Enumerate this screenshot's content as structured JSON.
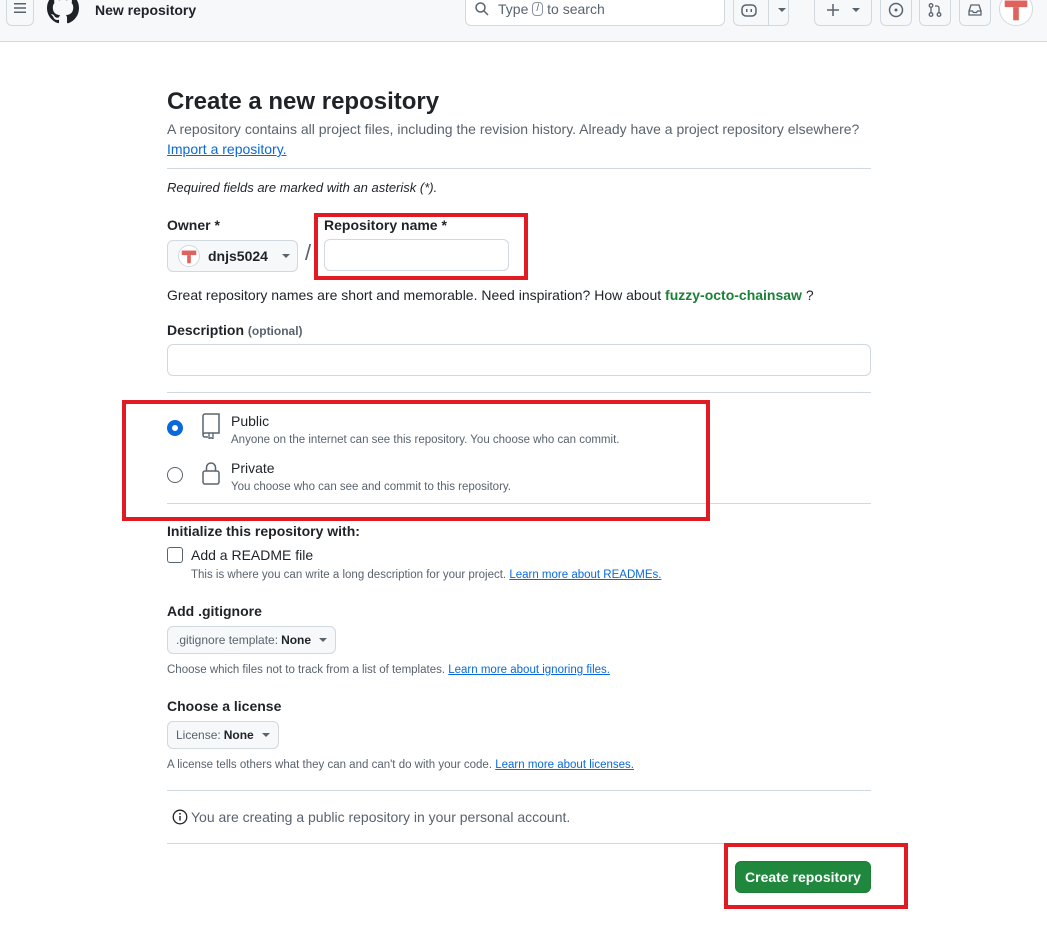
{
  "header": {
    "title": "New repository",
    "search_label_before": "Type",
    "search_key": "/",
    "search_label_after": "to search"
  },
  "page": {
    "title": "Create a new repository",
    "subtitle": "A repository contains all project files, including the revision history. Already have a project repository elsewhere?",
    "import_link": "Import a repository.",
    "required_note": "Required fields are marked with an asterisk (*)."
  },
  "owner": {
    "label": "Owner *",
    "value": "dnjs5024"
  },
  "separator": "/",
  "repo_name": {
    "label": "Repository name *",
    "value": "",
    "hint_before": "Great repository names are short and memorable. Need inspiration? How about",
    "suggestion": "fuzzy-octo-chainsaw",
    "hint_after": "?"
  },
  "description": {
    "label": "Description",
    "optional": "(optional)",
    "value": ""
  },
  "visibility": {
    "public": {
      "title": "Public",
      "desc": "Anyone on the internet can see this repository. You choose who can commit.",
      "checked": true
    },
    "private": {
      "title": "Private",
      "desc": "You choose who can see and commit to this repository.",
      "checked": false
    }
  },
  "initialize": {
    "label": "Initialize this repository with:",
    "readme_label": "Add a README file",
    "readme_desc": "This is where you can write a long description for your project.",
    "readme_link": "Learn more about READMEs."
  },
  "gitignore": {
    "label": "Add .gitignore",
    "select_prefix": ".gitignore template:",
    "select_value": "None",
    "desc": "Choose which files not to track from a list of templates.",
    "link": "Learn more about ignoring files."
  },
  "license": {
    "label": "Choose a license",
    "select_prefix": "License:",
    "select_value": "None",
    "desc": "A license tells others what they can and can't do with your code.",
    "link": "Learn more about licenses."
  },
  "info_text": "You are creating a public repository in your personal account.",
  "create_button": "Create repository",
  "colors": {
    "accent_blue": "#0969da",
    "primary_green": "#1f883d",
    "annotation_red": "#e01b24"
  }
}
